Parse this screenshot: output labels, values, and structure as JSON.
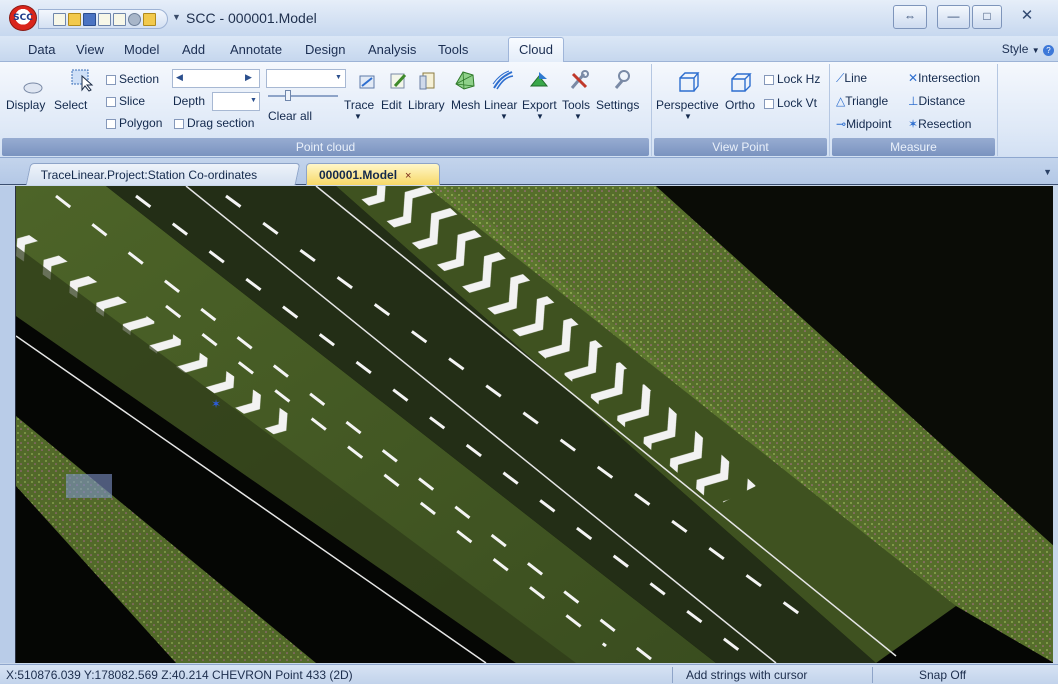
{
  "window": {
    "app_logo_text": "SCC",
    "title": "SCC - 000001.Model",
    "restore_special_symbol": "⇔",
    "minimize_symbol": "—",
    "maximize_symbol": "□",
    "close_symbol": "✕"
  },
  "menu": {
    "tabs": [
      "Data",
      "View",
      "Model",
      "Add",
      "Annotate",
      "Design",
      "Analysis",
      "Tools",
      "Cloud"
    ],
    "active_tab": "Cloud",
    "style_label": "Style"
  },
  "ribbon": {
    "point_cloud": {
      "label": "Point cloud",
      "display": "Display",
      "select": "Select",
      "section": "Section",
      "slice": "Slice",
      "polygon": "Polygon",
      "depth": "Depth",
      "drag_section": "Drag section",
      "clear_all": "Clear all",
      "trace": "Trace",
      "edit": "Edit",
      "library": "Library",
      "mesh": "Mesh",
      "linear": "Linear",
      "export": "Export",
      "tools": "Tools",
      "settings": "Settings"
    },
    "view_point": {
      "label": "View Point",
      "perspective": "Perspective",
      "ortho": "Ortho",
      "lock_hz": "Lock Hz",
      "lock_vt": "Lock Vt"
    },
    "measure": {
      "label": "Measure",
      "line": "Line",
      "intersection": "Intersection",
      "triangle": "Triangle",
      "distance": "Distance",
      "midpoint": "Midpoint",
      "resection": "Resection"
    }
  },
  "doc_tabs": {
    "inactive": "TraceLinear.Project:Station Co-ordinates",
    "active": "000001.Model",
    "close_symbol": "×"
  },
  "status": {
    "coords": "X:510876.039 Y:178082.569 Z:40.214  CHEVRON  Point 433  (2D)",
    "hint": "Add strings with cursor",
    "snap": "Snap Off"
  },
  "colors": {
    "ribbon_group_label": "#7a93c0",
    "active_doc_tab": "#f7d868",
    "viewport_bg": "#050604",
    "pointcloud_green": "#6d8a3a",
    "chevron_white": "#f2f2f2"
  }
}
